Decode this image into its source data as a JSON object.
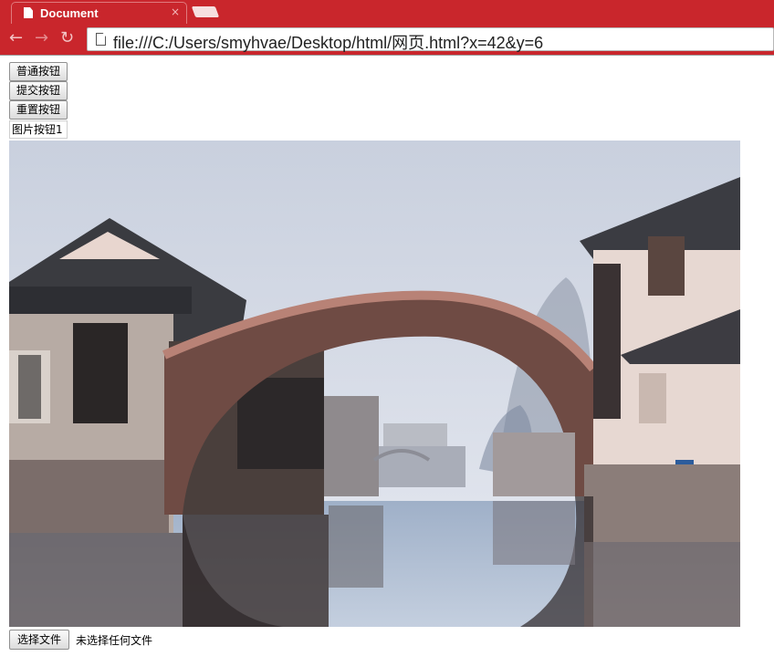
{
  "browser": {
    "tab_title": "Document",
    "tab_close": "×",
    "url": "file:///C:/Users/smyhvae/Desktop/html/网页.html?x=42&y=6",
    "back_glyph": "←",
    "forward_glyph": "→",
    "reload_glyph": "↻",
    "accent_color": "#c9262c"
  },
  "page": {
    "button_label": "普通按钮",
    "submit_label": "提交按钮",
    "reset_label": "重置按钮",
    "image_button_label": "图片按钮1",
    "photo_description_icon": "water-town-stone-bridge-photo",
    "file_button_label": "选择文件",
    "file_status": "未选择任何文件"
  }
}
